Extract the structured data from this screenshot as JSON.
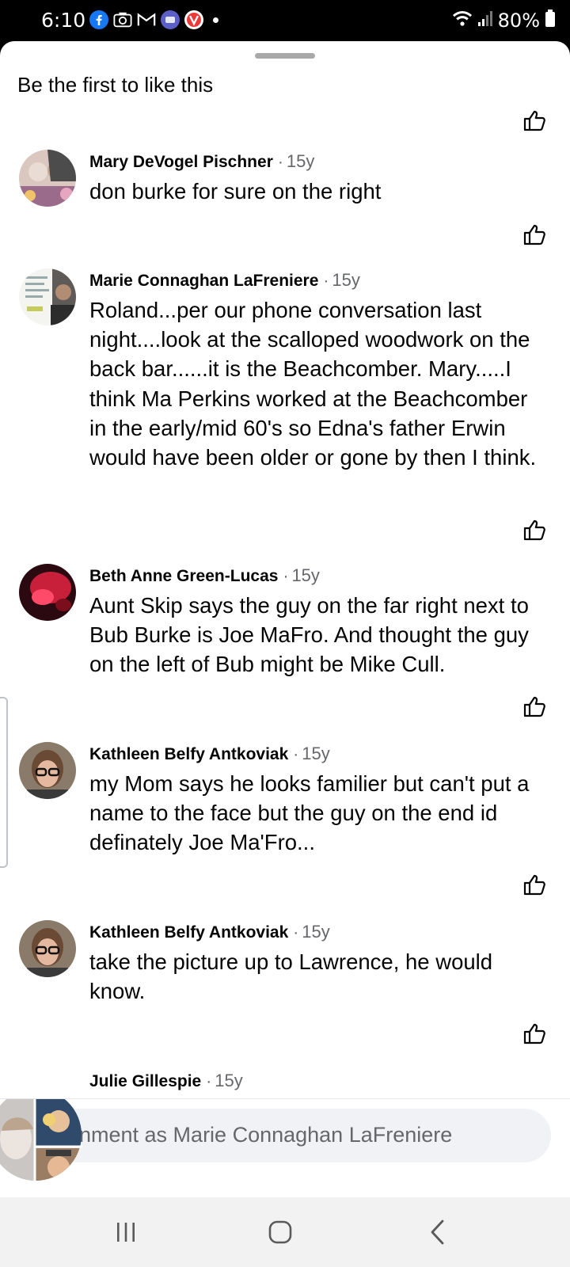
{
  "status_bar": {
    "time": "6:10",
    "battery": "80%",
    "left_icons": [
      "facebook-icon",
      "camera-icon",
      "gmail-icon",
      "app-icon",
      "vivaldi-icon",
      "dot-icon"
    ],
    "right_icons": [
      "wifi-icon",
      "signal-icon",
      "battery-icon"
    ]
  },
  "sheet": {
    "title": "Be the first to like this"
  },
  "comments": [
    {
      "author": "Mary DeVogel Pischner",
      "time": "15y",
      "text": "don burke for sure on the right"
    },
    {
      "author": "Marie Connaghan LaFreniere",
      "time": "15y",
      "text": "Roland...per our phone conversation last night....look at the scalloped woodwork on the back bar......it is the Beachcomber. Mary.....I think Ma Perkins worked at the Beachcomber in the early/mid 60's so Edna's father Erwin would have been older or gone by then I think."
    },
    {
      "author": "Beth Anne Green-Lucas",
      "time": "15y",
      "text": "Aunt Skip says the guy on the far right next to Bub Burke is Joe MaFro. And thought the guy on the left of Bub might be Mike Cull."
    },
    {
      "author": "Kathleen Belfy Antkoviak",
      "time": "15y",
      "text": "my Mom says he looks familier but can't put a name to the face but the guy on the end id definately Joe Ma'Fro..."
    },
    {
      "author": "Kathleen Belfy Antkoviak",
      "time": "15y",
      "text": "take the picture up to Lawrence, he would know."
    },
    {
      "author": "Julie Gillespie",
      "time": "15y",
      "text": ""
    }
  ],
  "composer": {
    "text": "nment as Marie Connaghan LaFreniere"
  },
  "nav": {
    "buttons": [
      "recents-icon",
      "home-icon",
      "back-icon"
    ]
  },
  "colors": {
    "facebook_blue": "#1877f2",
    "secondary_text": "#65676b",
    "primary_text": "#050505",
    "field_bg": "#f0f2f5"
  }
}
